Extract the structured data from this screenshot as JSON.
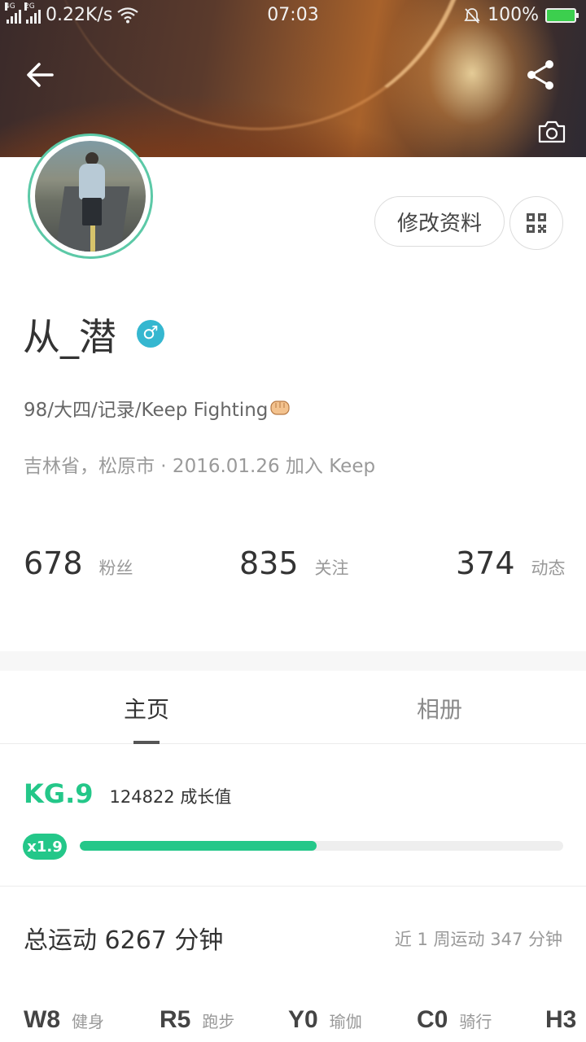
{
  "status_bar": {
    "net_tag_1": "4G",
    "net_tag_2": "2G",
    "speed": "0.22K/s",
    "time": "07:03",
    "battery": "100%",
    "icons": [
      "signal-icon",
      "signal-icon",
      "wifi-icon",
      "alarm-off-icon",
      "battery-icon"
    ]
  },
  "header": {
    "back_icon": "arrow-left-icon",
    "share_icon": "share-icon",
    "camera_icon": "camera-icon"
  },
  "profile": {
    "edit_label": "修改资料",
    "qr_icon": "qr-code-icon",
    "name": "从_潜",
    "gender_symbol": "♂",
    "bio": "98/大四/记录/Keep Fighting",
    "bio_emoji_icon": "fist-emoji-icon",
    "meta": "吉林省，松原市 · 2016.01.26 加入 Keep"
  },
  "stats": [
    {
      "value": "678",
      "label": "粉丝"
    },
    {
      "value": "835",
      "label": "关注"
    },
    {
      "value": "374",
      "label": "动态"
    }
  ],
  "tabs": [
    {
      "label": "主页",
      "active": true
    },
    {
      "label": "相册",
      "active": false
    }
  ],
  "level": {
    "kg": "KG.9",
    "growth": "124822 成长值",
    "multiplier": "x1.9",
    "progress_fraction": 0.49
  },
  "exercise": {
    "total": "总运动 6267 分钟",
    "week": "近 1 周运动 347 分钟",
    "sports": [
      {
        "code": "W8",
        "name": "健身"
      },
      {
        "code": "R5",
        "name": "跑步"
      },
      {
        "code": "Y0",
        "name": "瑜伽"
      },
      {
        "code": "C0",
        "name": "骑行"
      },
      {
        "code": "H3",
        "name": ""
      }
    ]
  },
  "colors": {
    "accent": "#24c789",
    "gender": "#35b7d0",
    "avatar_ring": "#5cc9a7"
  }
}
